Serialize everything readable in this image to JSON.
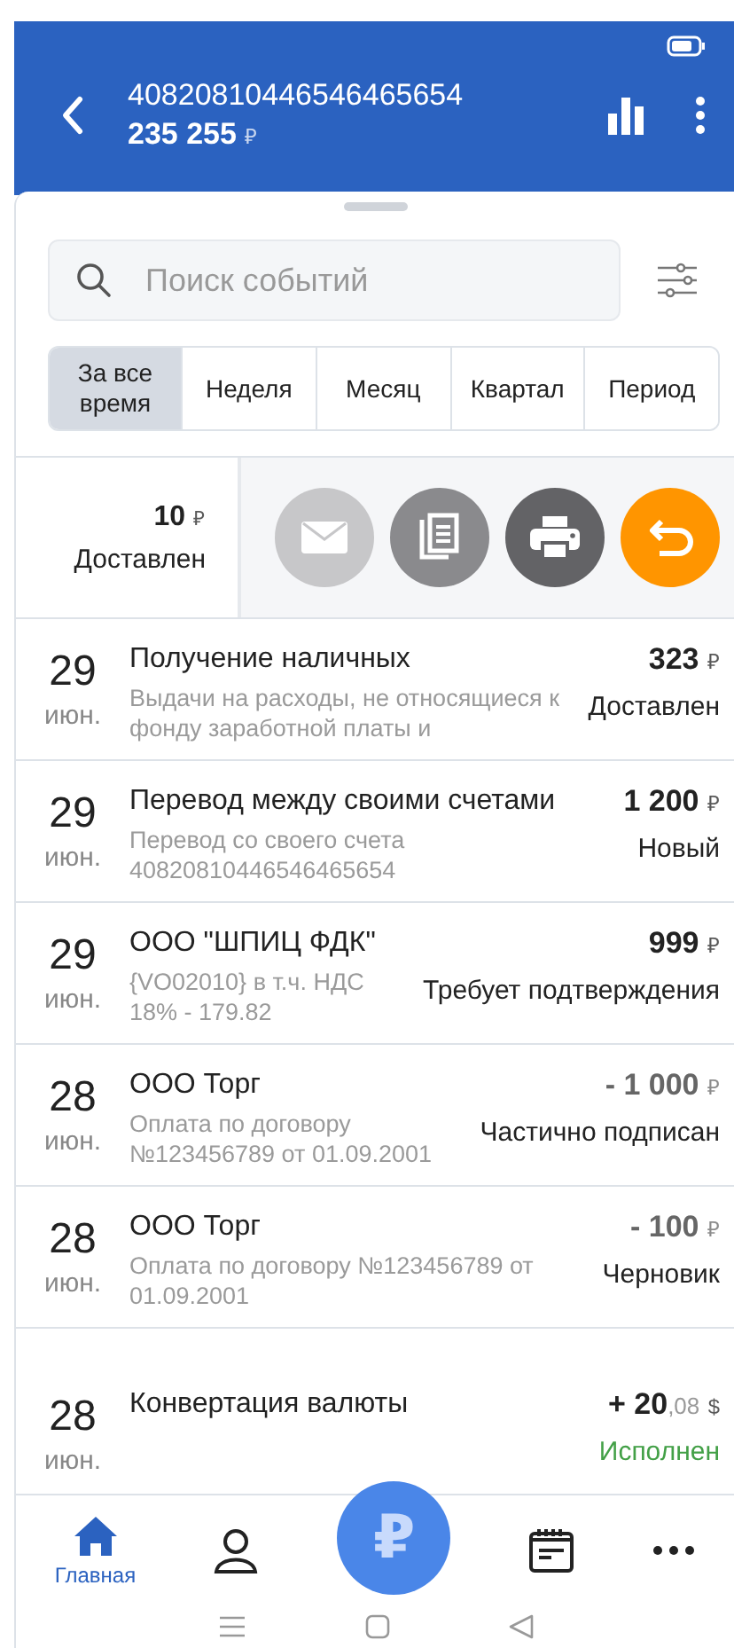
{
  "header": {
    "account": "40820810446546465654",
    "balance": "235 255",
    "currency": "₽"
  },
  "search": {
    "placeholder": "Поиск событий"
  },
  "periods": [
    {
      "label": "За все время",
      "selected": true
    },
    {
      "label": "Неделя",
      "selected": false
    },
    {
      "label": "Месяц",
      "selected": false
    },
    {
      "label": "Квартал",
      "selected": false
    },
    {
      "label": "Период",
      "selected": false
    }
  ],
  "swiped_row": {
    "amount": "10",
    "currency": "₽",
    "status": "Доставлен",
    "actions": [
      {
        "kind": "mail",
        "color": "#c7c7c9"
      },
      {
        "kind": "copy",
        "color": "#8a8a8d"
      },
      {
        "kind": "print",
        "color": "#636366"
      },
      {
        "kind": "undo",
        "color": "#ff9500"
      }
    ]
  },
  "events": [
    {
      "day": "29",
      "month": "июн.",
      "title": "Получение наличных",
      "details": "Выдачи на расходы, не относящиеся к фонду заработной платы и",
      "amount": "323",
      "currency": "₽",
      "muted": false,
      "status": "Доставлен",
      "done": false
    },
    {
      "day": "29",
      "month": "июн.",
      "title": "Перевод между своими счетами",
      "details": "Перевод со своего счета 40820810446546465654",
      "amount": "1 200",
      "currency": "₽",
      "muted": false,
      "status": "Новый",
      "done": false
    },
    {
      "day": "29",
      "month": "июн.",
      "title": "ООО \"ШПИЦ ФДК\"",
      "details": "{VO02010} в т.ч. НДС 18% - 179.82",
      "amount": "999",
      "currency": "₽",
      "muted": false,
      "status": "Требует подтверждения",
      "done": false
    },
    {
      "day": "28",
      "month": "июн.",
      "title": "ООО Торг",
      "details": "Оплата по договору №123456789 от 01.09.2001",
      "amount": "- 1 000",
      "currency": "₽",
      "muted": true,
      "status": "Частично подписан",
      "done": false
    },
    {
      "day": "28",
      "month": "июн.",
      "title": "ООО Торг",
      "details": "Оплата по договору №123456789 от 01.09.2001",
      "amount": "- 100",
      "currency": "₽",
      "muted": true,
      "status": "Черновик",
      "done": false
    },
    {
      "day": "28",
      "month": "июн.",
      "title": "Конвертация валюты",
      "amount": "+ 20",
      "fraction": ",08",
      "currency": "$",
      "muted": false,
      "status": "Исполнен",
      "done": true
    }
  ],
  "nav": [
    {
      "kind": "home",
      "label": "Главная",
      "selected": true
    },
    {
      "kind": "profile",
      "selected": false
    },
    {
      "kind": "payment",
      "symbol": "₽",
      "selected": false
    },
    {
      "kind": "calendar",
      "selected": false
    },
    {
      "kind": "more",
      "selected": false
    }
  ]
}
